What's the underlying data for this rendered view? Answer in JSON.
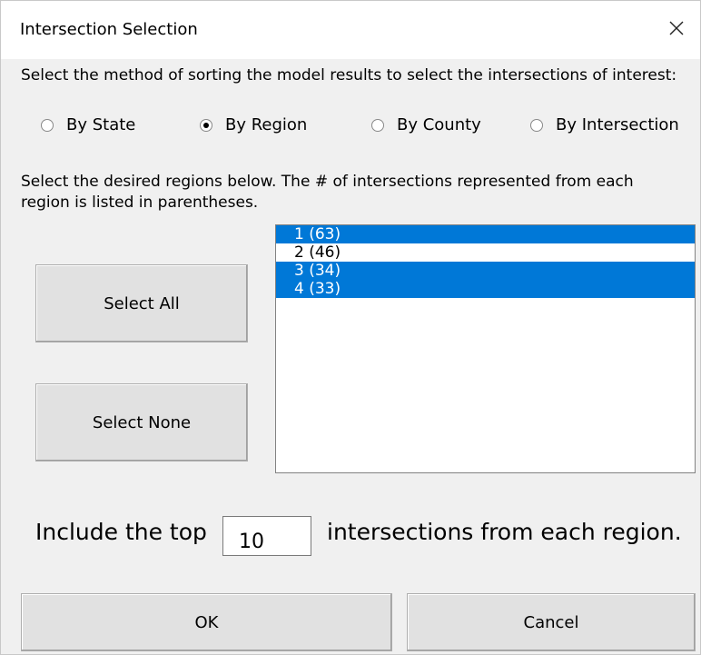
{
  "window": {
    "title": "Intersection Selection",
    "close_icon": "close-icon"
  },
  "instruction_sort": "Select the method of sorting the model results to select the intersections of interest:",
  "sort_options": [
    {
      "label": "By State",
      "selected": false
    },
    {
      "label": "By Region",
      "selected": true
    },
    {
      "label": "By County",
      "selected": false
    },
    {
      "label": "By Intersection",
      "selected": false
    }
  ],
  "instruction_regions_line1": "Select the desired regions below. The # of intersections represented from each",
  "instruction_regions_line2": "region is listed in parentheses.",
  "buttons": {
    "select_all": "Select All",
    "select_none": "Select None",
    "ok": "OK",
    "cancel": "Cancel"
  },
  "regions": [
    {
      "label": "1 (63)",
      "selected": true
    },
    {
      "label": "2 (46)",
      "selected": false
    },
    {
      "label": "3 (34)",
      "selected": true
    },
    {
      "label": "4 (33)",
      "selected": true
    }
  ],
  "top_n": {
    "prefix": "Include the top",
    "value": "10",
    "suffix": "intersections from each region."
  },
  "colors": {
    "selection": "#0078d7",
    "dialog_bg": "#f0f0f0"
  }
}
